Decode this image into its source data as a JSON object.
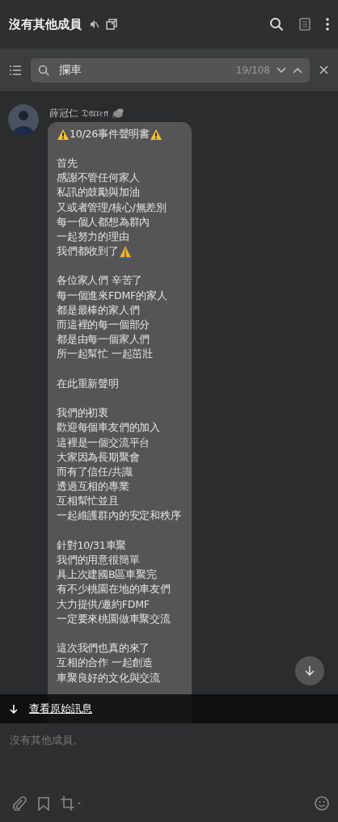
{
  "header": {
    "title": "沒有其他成員",
    "muted": true
  },
  "search": {
    "value": "攔車",
    "count": "19/108"
  },
  "message": {
    "sender": "薛冠仁 𝔇𝔞𝔯𝔯𝔢𝔫",
    "paragraphs": [
      [
        {
          "text": "10/26事件聲明書",
          "kind": "warning-title"
        }
      ],
      [
        {
          "text": "首先"
        },
        {
          "text": "感謝不管任何家人"
        },
        {
          "text": "私訊的鼓勵與加油"
        },
        {
          "text": "又或者管理/核心/無差別"
        },
        {
          "text": "每一個人都想為群內"
        },
        {
          "text": "一起努力的理由"
        },
        {
          "text": "我們都收到了",
          "kind": "pray"
        }
      ],
      [
        {
          "text": "各位家人們 辛苦了"
        },
        {
          "text": "每一個進來FDMF的家人"
        },
        {
          "text": "都是最棒的家人們"
        },
        {
          "text": "而這裡的每一個部分"
        },
        {
          "text": "都是由每一個家人們"
        },
        {
          "text": "所一起幫忙 一起茁壯"
        }
      ],
      [
        {
          "text": "在此重新聲明"
        }
      ],
      [
        {
          "text": "我們的初衷"
        },
        {
          "text": "歡迎每個車友們的加入"
        },
        {
          "text": "這裡是一個交流平台"
        },
        {
          "text": "大家因為長期聚會"
        },
        {
          "text": "而有了信任/共識"
        },
        {
          "text": "透過互相的專業"
        },
        {
          "text": "互相幫忙並且"
        },
        {
          "text": "一起維護群內的安定和秩序"
        }
      ],
      [
        {
          "text": "針對10/31車聚"
        },
        {
          "text": "我們的用意很簡單"
        },
        {
          "text": "具上次建國B區車聚完"
        },
        {
          "text": "有不少桃園在地的車友們"
        },
        {
          "text": "大力提供/邀約FDMF"
        },
        {
          "text": "一定要來桃園做車聚交流"
        }
      ],
      [
        {
          "text": "這次我們也真的來了"
        },
        {
          "text": "互相的合作 一起創造"
        },
        {
          "text": "車聚良好的文化與交流"
        }
      ]
    ]
  },
  "view_original": "查看原始訊息",
  "composer": {
    "placeholder": "沒有其他成員。"
  }
}
